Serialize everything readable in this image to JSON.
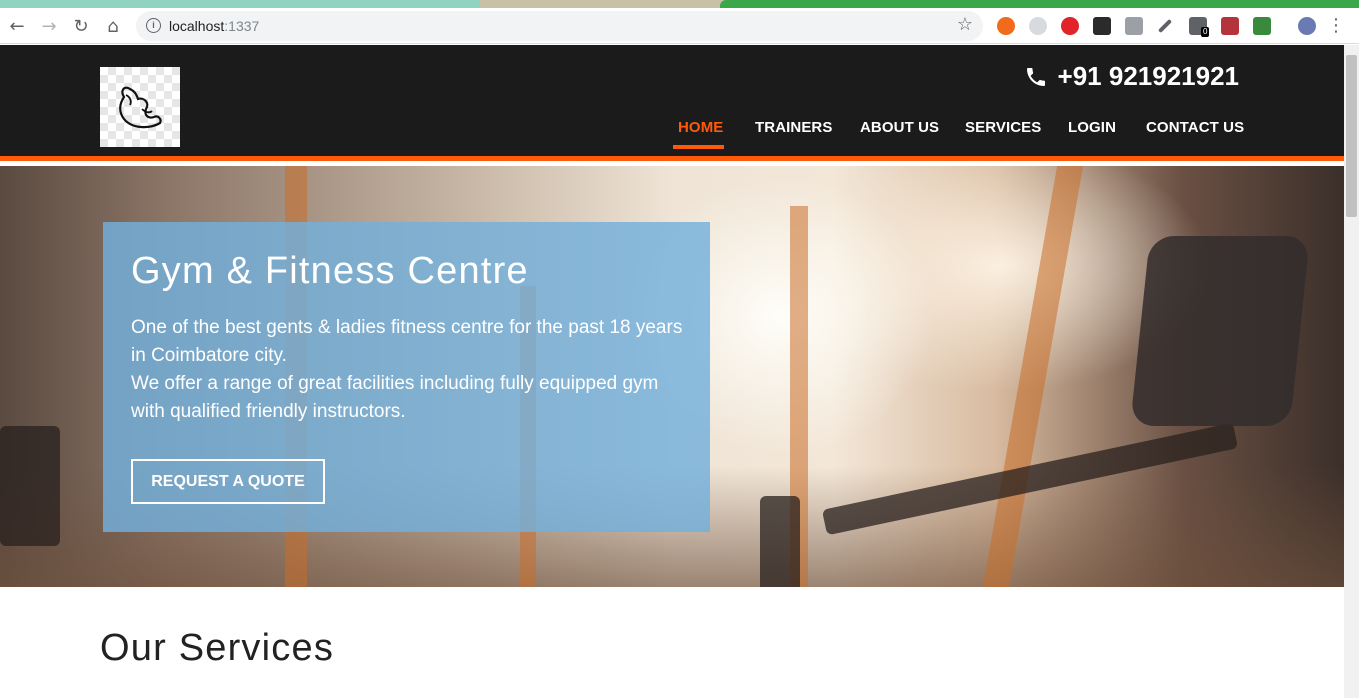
{
  "browser": {
    "url_host": "localhost",
    "url_port": ":1337",
    "extension_badge": "0"
  },
  "site": {
    "phone": "+91 921921921",
    "nav": [
      {
        "label": "HOME",
        "active": true
      },
      {
        "label": "TRAINERS",
        "active": false
      },
      {
        "label": "ABOUT US",
        "active": false
      },
      {
        "label": "SERVICES",
        "active": false
      },
      {
        "label": "LOGIN",
        "active": false
      },
      {
        "label": "CONTACT US",
        "active": false
      }
    ],
    "accent_color": "#ff5a0a",
    "header_color": "#1b1b1b"
  },
  "hero": {
    "title": "Gym & Fitness Centre",
    "text_line1": "One of the best gents & ladies fitness centre for the past 18 years in Coimbatore city.",
    "text_line2": "We offer a range of great facilities including fully equipped gym with qualified friendly instructors.",
    "cta_label": "REQUEST A QUOTE"
  },
  "services": {
    "title": "Our Services"
  }
}
